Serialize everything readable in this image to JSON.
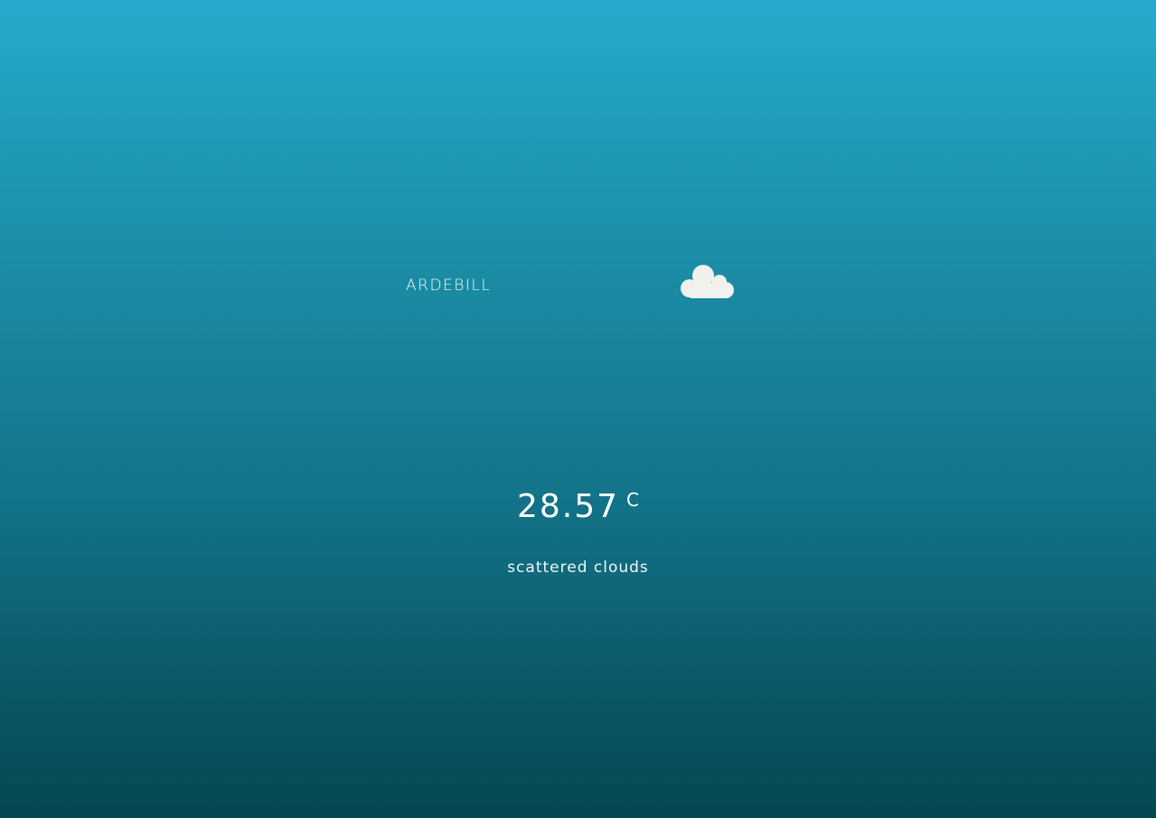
{
  "location": {
    "city": "ARDEBILL"
  },
  "weather": {
    "icon": "cloud-icon",
    "icon_color": "#f1f1ee",
    "temperature": "28.57",
    "unit": "C",
    "description": "scattered clouds"
  },
  "colors": {
    "background_top": "#25aacd",
    "background_bottom": "#044753",
    "text": "#ffffff"
  }
}
